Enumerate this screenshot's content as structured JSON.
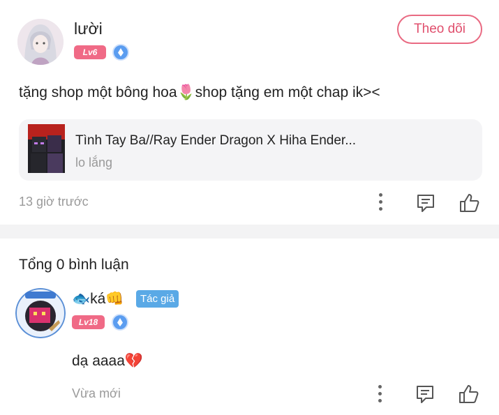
{
  "post": {
    "username": "lười",
    "level": "Lv6",
    "follow_label": "Theo dõi",
    "content": "tặng shop một bông hoa🌷shop tặng em một chap ik><",
    "chapter": {
      "title": "Tình Tay Ba//Ray Ender Dragon X Hiha Ender...",
      "subtitle": "lo lắng"
    },
    "time": "13 giờ trước"
  },
  "comments": {
    "total_label": "Tổng 0 bình luận",
    "items": [
      {
        "username": "🐟ká👊",
        "author_badge": "Tác giả",
        "level": "Lv18",
        "content": "dạ aaaa💔",
        "time": "Vừa mới"
      }
    ]
  },
  "colors": {
    "accent": "#e96a82",
    "level_badge": "#f06a86",
    "author_badge": "#5aa9e6",
    "muted_text": "#9a9a9a"
  },
  "icons": [
    "diamond-icon",
    "more-icon",
    "comment-icon",
    "like-icon"
  ]
}
